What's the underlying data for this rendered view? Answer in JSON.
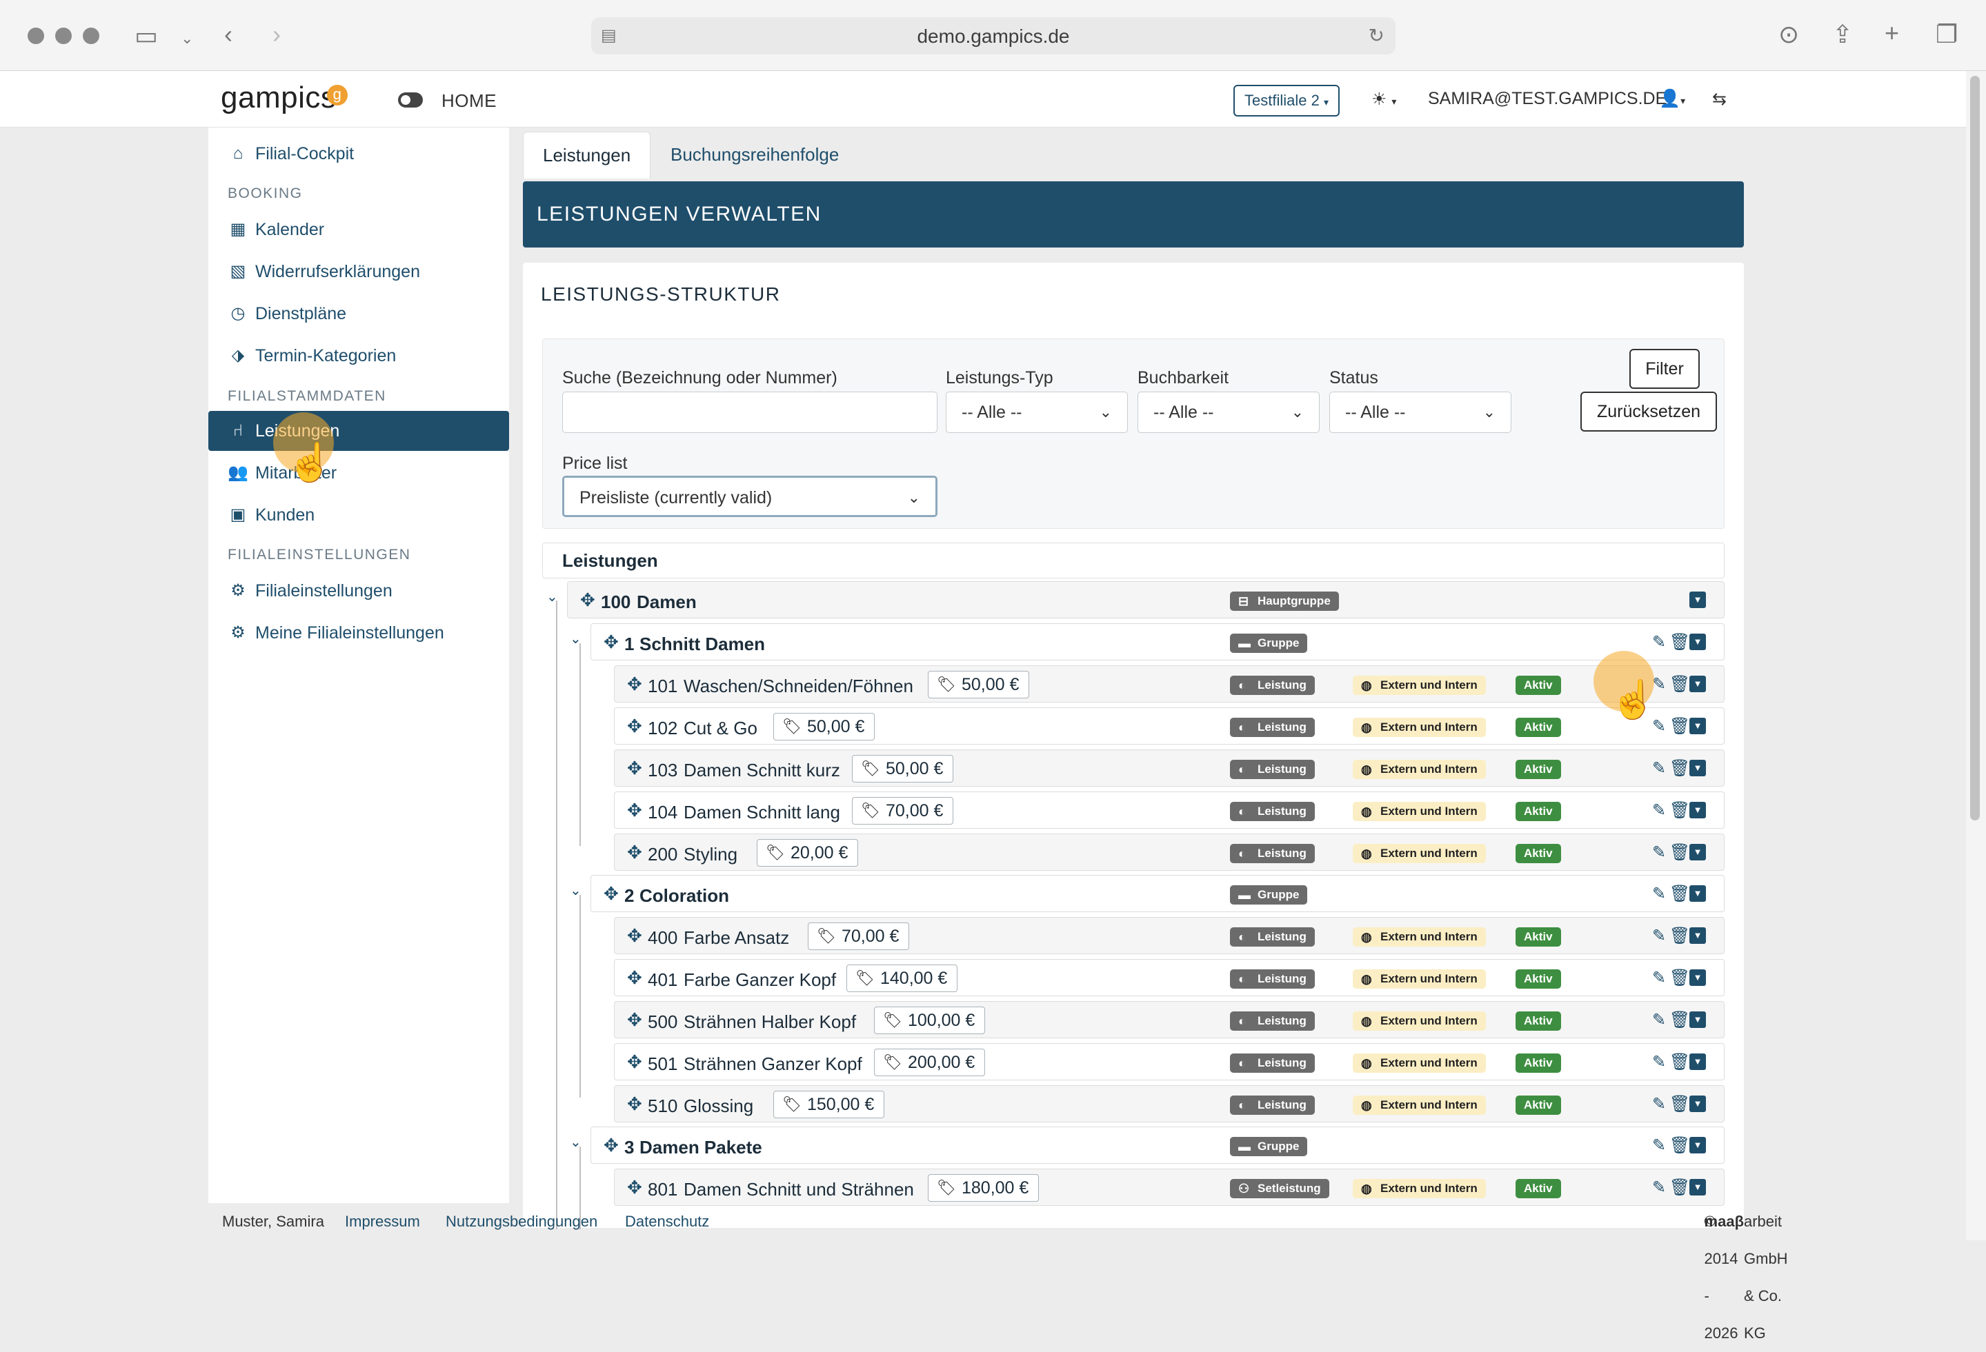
{
  "browser": {
    "url": "demo.gampics.de"
  },
  "app": {
    "logo": "gampics",
    "logo_mark": "g",
    "home": "HOME",
    "branch": "Testfiliale 2",
    "user": "SAMIRA@TEST.GAMPICS.DE"
  },
  "sidebar": {
    "cockpit": "Filial-Cockpit",
    "sec_booking": "BOOKING",
    "kalender": "Kalender",
    "widerruf": "Widerrufserklärungen",
    "dienstplaene": "Dienstpläne",
    "termin": "Termin-Kategorien",
    "sec_stamm": "FILIALSTAMMDATEN",
    "leistungen": "Leistungen",
    "mitarbeiter": "Mitarbeiter",
    "kunden": "Kunden",
    "sec_einst": "FILIALEINSTELLUNGEN",
    "filialeinst": "Filialeinstellungen",
    "meine": "Meine Filialeinstellungen"
  },
  "tabs": {
    "t1": "Leistungen",
    "t2": "Buchungsreihenfolge"
  },
  "banner": "LEISTUNGEN VERWALTEN",
  "card": {
    "title": "LEISTUNGS-STRUKTUR"
  },
  "filters": {
    "search_label": "Suche (Bezeichnung oder Nummer)",
    "search_value": "",
    "type_label": "Leistungs-Typ",
    "type_value": "-- Alle --",
    "book_label": "Buchbarkeit",
    "book_value": "-- Alle --",
    "status_label": "Status",
    "status_value": "-- Alle --",
    "filter_btn": "Filter",
    "reset_btn": "Zurücksetzen",
    "price_label": "Price list",
    "price_value": "Preisliste (currently valid)"
  },
  "list": {
    "header": "Leistungen",
    "main": {
      "num": "100",
      "name": "Damen",
      "type": "Hauptgruppe"
    },
    "group1": {
      "num": "1",
      "name": "Schnitt Damen",
      "type": "Gruppe"
    },
    "r101": {
      "num": "101",
      "name": "Waschen/Schneiden/Föhnen",
      "price": "50,00 €",
      "type": "Leistung",
      "book": "Extern und Intern",
      "status": "Aktiv"
    },
    "r102": {
      "num": "102",
      "name": "Cut & Go",
      "price": "50,00 €",
      "type": "Leistung",
      "book": "Extern und Intern",
      "status": "Aktiv"
    },
    "r103": {
      "num": "103",
      "name": "Damen Schnitt kurz",
      "price": "50,00 €",
      "type": "Leistung",
      "book": "Extern und Intern",
      "status": "Aktiv"
    },
    "r104": {
      "num": "104",
      "name": "Damen Schnitt lang",
      "price": "70,00 €",
      "type": "Leistung",
      "book": "Extern und Intern",
      "status": "Aktiv"
    },
    "r200": {
      "num": "200",
      "name": "Styling",
      "price": "20,00 €",
      "type": "Leistung",
      "book": "Extern und Intern",
      "status": "Aktiv"
    },
    "group2": {
      "num": "2",
      "name": "Coloration",
      "type": "Gruppe"
    },
    "r400": {
      "num": "400",
      "name": "Farbe Ansatz",
      "price": "70,00 €",
      "type": "Leistung",
      "book": "Extern und Intern",
      "status": "Aktiv"
    },
    "r401": {
      "num": "401",
      "name": "Farbe Ganzer Kopf",
      "price": "140,00 €",
      "type": "Leistung",
      "book": "Extern und Intern",
      "status": "Aktiv"
    },
    "r500": {
      "num": "500",
      "name": "Strähnen Halber Kopf",
      "price": "100,00 €",
      "type": "Leistung",
      "book": "Extern und Intern",
      "status": "Aktiv"
    },
    "r501": {
      "num": "501",
      "name": "Strähnen Ganzer Kopf",
      "price": "200,00 €",
      "type": "Leistung",
      "book": "Extern und Intern",
      "status": "Aktiv"
    },
    "r510": {
      "num": "510",
      "name": "Glossing",
      "price": "150,00 €",
      "type": "Leistung",
      "book": "Extern und Intern",
      "status": "Aktiv"
    },
    "group3": {
      "num": "3",
      "name": "Damen Pakete",
      "type": "Gruppe"
    },
    "r801": {
      "num": "801",
      "name": "Damen Schnitt und Strähnen",
      "price": "180,00 €",
      "type": "Setleistung",
      "book": "Extern und Intern",
      "status": "Aktiv"
    }
  },
  "footer": {
    "user": "Muster, Samira",
    "impressum": "Impressum",
    "nutzung": "Nutzungsbedingungen",
    "datenschutz": "Datenschutz",
    "copyright_pre": "© 2014 - 2026 ",
    "copyright_brand": "maaβ",
    "copyright_post": "arbeit GmbH & Co. KG"
  }
}
